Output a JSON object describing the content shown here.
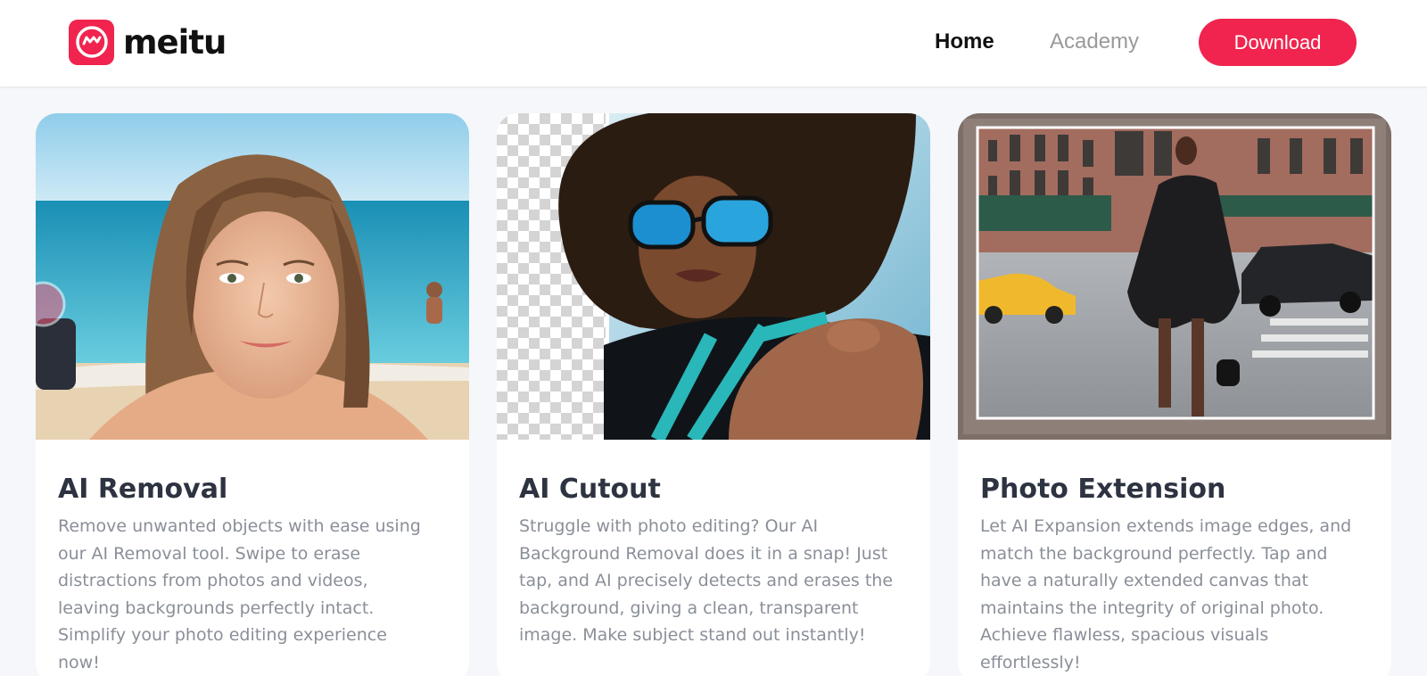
{
  "header": {
    "logo_text": "meitu",
    "nav": {
      "home": "Home",
      "academy": "Academy"
    },
    "download_label": "Download"
  },
  "colors": {
    "brand": "#f0244e",
    "title": "#2d3340",
    "body_text": "#8a8f98",
    "nav_inactive": "#9a9a9a",
    "background": "#f5f7fa"
  },
  "icons": {
    "logo": "meitu-logo-icon",
    "checker": "transparency-checkerboard"
  },
  "cards": [
    {
      "title": "AI Removal",
      "description": "Remove unwanted objects with ease using our AI Removal tool. Swipe to erase distractions from photos and videos, leaving backgrounds perfectly intact. Simplify your photo editing experience now!"
    },
    {
      "title": "AI Cutout",
      "description": "Struggle with photo editing? Our AI Background Removal does it in a snap! Just tap, and AI precisely detects and erases the background, giving a clean, transparent image. Make subject stand out instantly!"
    },
    {
      "title": "Photo Extension",
      "description": "Let AI Expansion extends image edges, and match the background perfectly. Tap and have a naturally extended canvas that maintains the integrity of original photo. Achieve flawless, spacious visuals effortlessly!"
    }
  ]
}
